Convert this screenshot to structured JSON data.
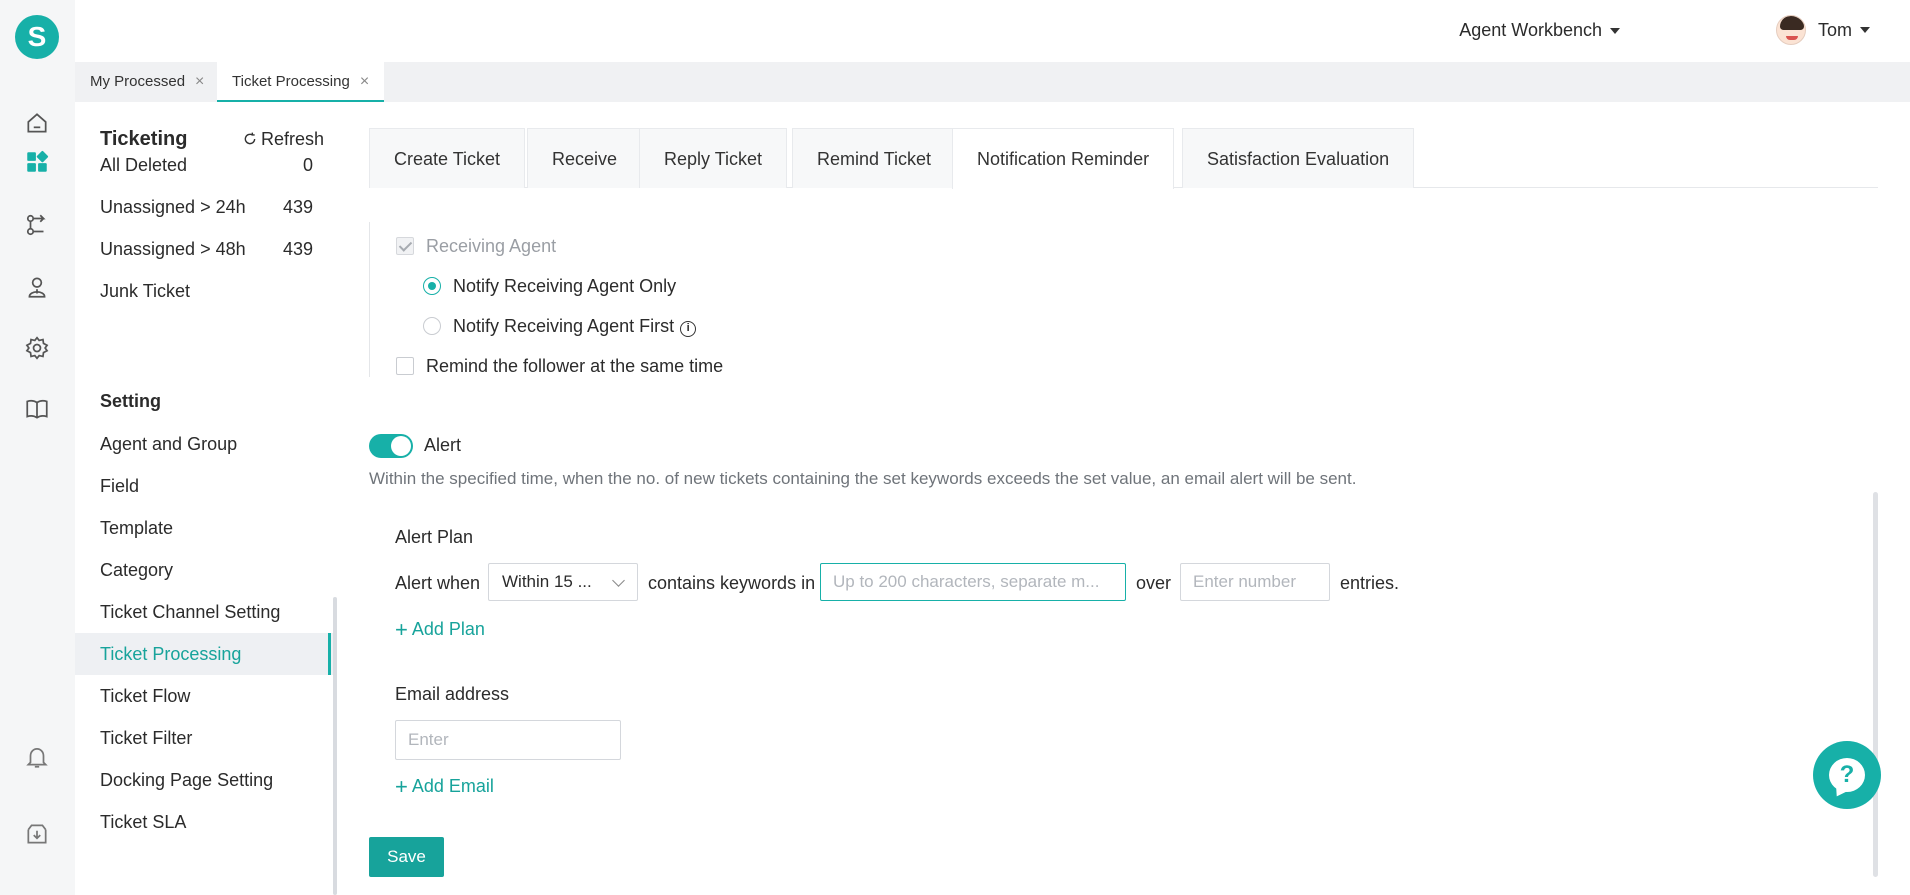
{
  "brand": {
    "logo_letter": "S",
    "accent": "#17b0a8"
  },
  "rail": {
    "icons": [
      "home-icon",
      "dashboard-icon",
      "routing-icon",
      "agent-icon",
      "settings-icon",
      "knowledge-book-icon",
      "bell-icon",
      "download-icon"
    ]
  },
  "header": {
    "workbench_label": "Agent Workbench",
    "user_name": "Tom"
  },
  "page_tabs": [
    {
      "label": "My Processed",
      "close": "×"
    },
    {
      "label": "Ticket Processing",
      "close": "×"
    }
  ],
  "sidebar": {
    "title": "Ticketing",
    "refresh_label": "Refresh",
    "items": [
      {
        "label": "All Deleted",
        "count": "0"
      },
      {
        "label": "Unassigned > 24h",
        "count": "439"
      },
      {
        "label": "Unassigned > 48h",
        "count": "439"
      },
      {
        "label": "Junk Ticket",
        "count": ""
      }
    ],
    "setting_title": "Setting",
    "setting_items": [
      "Agent and Group",
      "Field",
      "Template",
      "Category",
      "Ticket Channel Setting",
      "Ticket Processing",
      "Ticket Flow",
      "Ticket Filter",
      "Docking Page Setting",
      "Ticket SLA"
    ]
  },
  "content_tabs": [
    "Create Ticket",
    "Receive",
    "Reply Ticket",
    "Remind Ticket",
    "Notification Reminder",
    "Satisfaction Evaluation"
  ],
  "notification": {
    "receiving_agent": "Receiving Agent",
    "option_only": "Notify Receiving Agent Only",
    "option_first": "Notify Receiving Agent First",
    "info_glyph": "i",
    "remind_follower": "Remind the follower at the same time"
  },
  "alert": {
    "toggle_label": "Alert",
    "description": "Within the specified time, when the no. of new tickets containing the set keywords exceeds the set value, an email alert will be sent.",
    "plan_title": "Alert Plan",
    "alert_when": "Alert when",
    "time_select_value": "Within 15 ...",
    "contains_keywords": "contains keywords in",
    "keywords_placeholder": "Up to 200 characters, separate m...",
    "over": "over",
    "number_placeholder": "Enter number",
    "entries": "entries.",
    "add_plan": "Add Plan",
    "email_title": "Email address",
    "email_placeholder": "Enter",
    "add_email": "Add Email",
    "plus": "+"
  },
  "save_label": "Save",
  "help_glyph": "?"
}
